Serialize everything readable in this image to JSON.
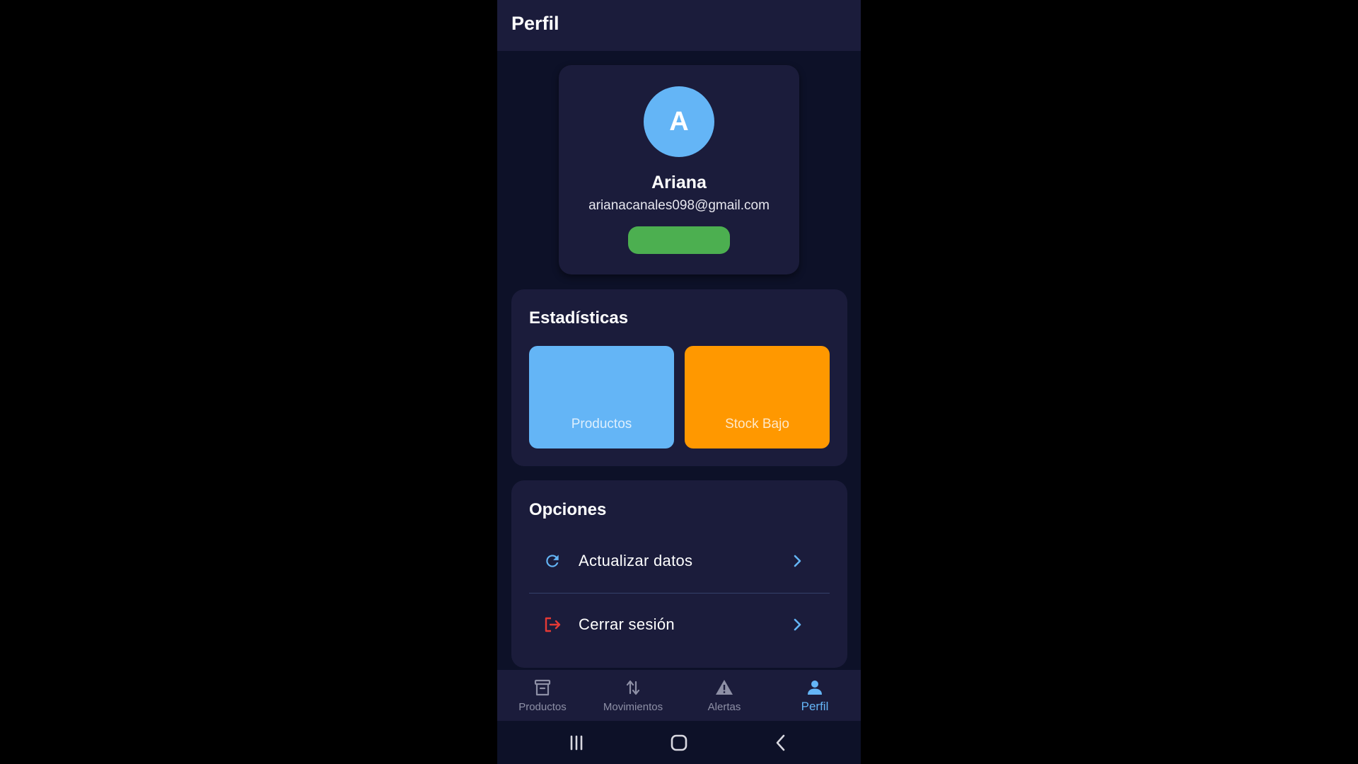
{
  "appbar": {
    "title": "Perfil"
  },
  "profile": {
    "avatar_letter": "A",
    "name": "Ariana",
    "email": "arianacanales098@gmail.com",
    "avatar_color": "#64b5f6",
    "badge_color": "#4caf50"
  },
  "stats": {
    "title": "Estadísticas",
    "tiles": [
      {
        "label": "Productos",
        "color": "#64b5f6"
      },
      {
        "label": "Stock Bajo",
        "color": "#ff9800"
      }
    ]
  },
  "options": {
    "title": "Opciones",
    "items": [
      {
        "label": "Actualizar datos",
        "icon": "refresh-icon",
        "icon_color": "#64b5f6"
      },
      {
        "label": "Cerrar sesión",
        "icon": "logout-icon",
        "icon_color": "#e53935"
      }
    ]
  },
  "bottom_nav": {
    "active_color": "#64b5f6",
    "items": [
      {
        "label": "Productos",
        "icon": "archive-box-icon"
      },
      {
        "label": "Movimientos",
        "icon": "swap-vertical-icon"
      },
      {
        "label": "Alertas",
        "icon": "warning-icon"
      },
      {
        "label": "Perfil",
        "icon": "person-icon"
      }
    ],
    "active_index": 3
  },
  "system_nav": {
    "items": [
      {
        "icon": "recent-apps-icon"
      },
      {
        "icon": "home-icon"
      },
      {
        "icon": "back-icon"
      }
    ]
  }
}
